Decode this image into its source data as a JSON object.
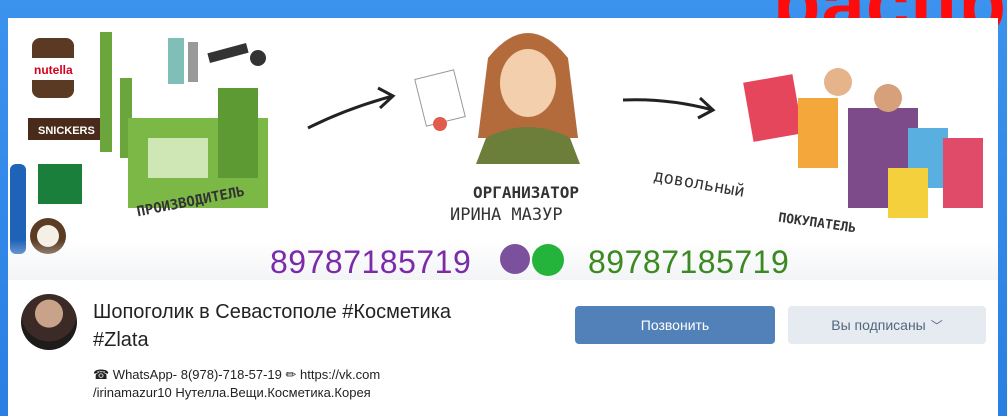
{
  "overlay_title": "распр",
  "cover": {
    "phone_left": "89787185719",
    "phone_right": "89787185719",
    "caption_producer": "ПРОИЗВОДИТЕЛЬ",
    "caption_organizer_role": "ОРГАНИЗАТОР",
    "caption_organizer_name": "ИРИНА МАЗУР",
    "caption_buyer_1": "довольный",
    "caption_buyer_2": "ПОКУПАТЕЛЬ",
    "product_labels": [
      "nutella",
      "SNICKERS"
    ]
  },
  "group": {
    "title_line1": "Шопоголик в Севастополе #Косметика",
    "title_line2": "#Zlata",
    "desc_line1": "☎ WhatsApp- 8(978)-718-57-19 ✏ https://vk.com",
    "desc_line2": "/irinamazur10 Нутелла.Вещи.Косметика.Корея"
  },
  "buttons": {
    "call": "Позвонить",
    "subscribed": "Вы подписаны",
    "subscribed_chevron": "﹀"
  }
}
